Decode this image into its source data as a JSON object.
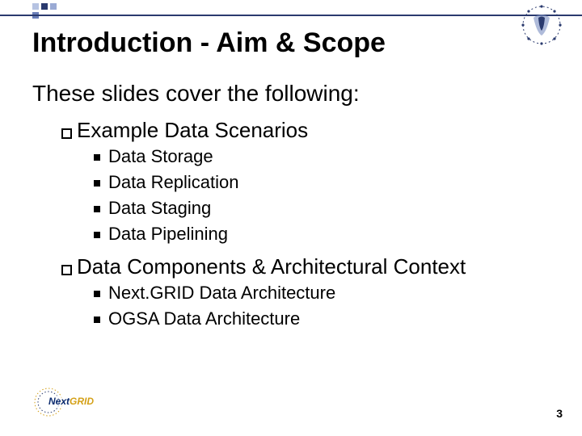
{
  "slide": {
    "title": "Introduction - Aim & Scope",
    "lead": "These slides cover the following:",
    "sections": [
      {
        "heading": "Example Data Scenarios",
        "items": [
          "Data Storage",
          "Data Replication",
          "Data Staging",
          "Data Pipelining"
        ]
      },
      {
        "heading": "Data Components & Architectural Context",
        "items": [
          "Next.GRID Data Architecture",
          "OGSA Data Architecture"
        ]
      }
    ],
    "page_number": "3",
    "footer_brand_left": "Next",
    "footer_brand_right": "GRID"
  }
}
